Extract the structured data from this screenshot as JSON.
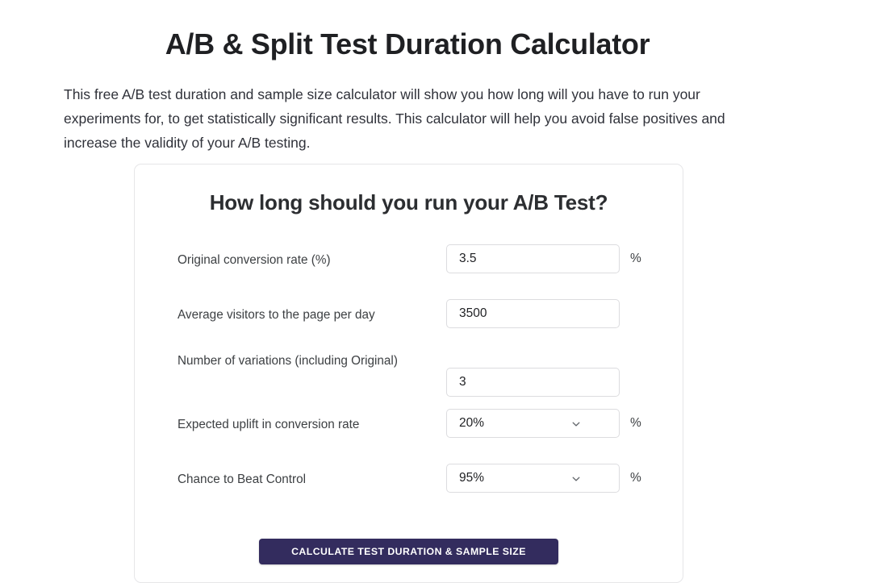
{
  "page": {
    "title": "A/B & Split Test Duration Calculator",
    "intro": "This free A/B test duration and sample size calculator will show you how long will you have to run your experiments for, to get statistically significant results. This calculator will help you avoid false positives and increase the validity of your A/B testing."
  },
  "card": {
    "title": "How long should you run your A/B Test?",
    "fields": [
      {
        "label": "Original conversion rate (%)",
        "type": "text",
        "value": "3.5",
        "suffix": "%",
        "name": "original-conversion-rate"
      },
      {
        "label": "Average visitors to the page per day",
        "type": "text",
        "value": "3500",
        "suffix": "",
        "name": "average-visitors-per-day"
      },
      {
        "label": "Number of variations (including Original)",
        "type": "text",
        "value": "3",
        "suffix": "",
        "name": "number-of-variations"
      },
      {
        "label": "Expected uplift in conversion rate",
        "type": "select",
        "value": "20%",
        "suffix": "%",
        "name": "expected-uplift"
      },
      {
        "label": "Chance to Beat Control",
        "type": "select",
        "value": "95%",
        "suffix": "%",
        "name": "chance-to-beat-control"
      }
    ],
    "submit_label": "Calculate Test Duration & Sample Size"
  },
  "colors": {
    "button_background": "#332c5e",
    "button_text": "#ffffff",
    "card_border": "#e6e6e8",
    "input_border": "#dcdcdf",
    "heading_text": "#2c2e31",
    "label_text": "#3d4043"
  },
  "icons": {
    "chevron_down": "chevron-down-icon"
  }
}
